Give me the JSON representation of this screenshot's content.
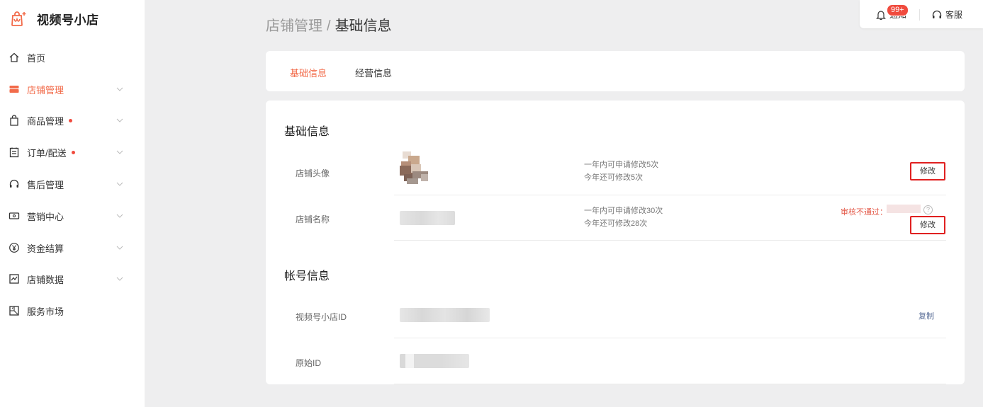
{
  "brand": {
    "name": "视频号小店"
  },
  "sidebar": {
    "items": [
      {
        "label": "首页",
        "icon": "home-icon",
        "active": false,
        "dot": false,
        "has_chevron": false
      },
      {
        "label": "店铺管理",
        "icon": "store-icon",
        "active": true,
        "dot": false,
        "has_chevron": true
      },
      {
        "label": "商品管理",
        "icon": "shopping-bag-icon",
        "active": false,
        "dot": true,
        "has_chevron": true
      },
      {
        "label": "订单/配送",
        "icon": "order-list-icon",
        "active": false,
        "dot": true,
        "has_chevron": true
      },
      {
        "label": "售后管理",
        "icon": "headset-icon",
        "active": false,
        "dot": false,
        "has_chevron": true
      },
      {
        "label": "营销中心",
        "icon": "ticket-icon",
        "active": false,
        "dot": false,
        "has_chevron": true
      },
      {
        "label": "资金结算",
        "icon": "yuan-icon",
        "active": false,
        "dot": false,
        "has_chevron": true
      },
      {
        "label": "店铺数据",
        "icon": "chart-icon",
        "active": false,
        "dot": false,
        "has_chevron": true
      },
      {
        "label": "服务市场",
        "icon": "market-icon",
        "active": false,
        "dot": false,
        "has_chevron": false
      }
    ]
  },
  "breadcrumb": {
    "parent": "店铺管理",
    "separator": "/",
    "current": "基础信息"
  },
  "topbar": {
    "notification_label": "通知",
    "notification_badge": "99+",
    "service_label": "客服"
  },
  "tabs": [
    {
      "label": "基础信息",
      "active": true
    },
    {
      "label": "经营信息",
      "active": false
    }
  ],
  "basic_info": {
    "title": "基础信息",
    "rows": [
      {
        "label": "店铺头像",
        "hint_line1": "一年内可申请修改5次",
        "hint_line2": "今年还可修改5次",
        "action": "修改"
      },
      {
        "label": "店铺名称",
        "hint_line1": "一年内可申请修改30次",
        "hint_line2": "今年还可修改28次",
        "action": "修改",
        "status": "审核不通过：",
        "help": "?"
      }
    ]
  },
  "account_info": {
    "title": "帐号信息",
    "rows": [
      {
        "label": "视频号小店ID",
        "action": "复制"
      },
      {
        "label": "原始ID"
      }
    ]
  },
  "colors": {
    "accent": "#f26b4a",
    "danger": "#e02020",
    "badge": "#f04b3e",
    "link": "#576b95",
    "background": "#eeeeef"
  }
}
